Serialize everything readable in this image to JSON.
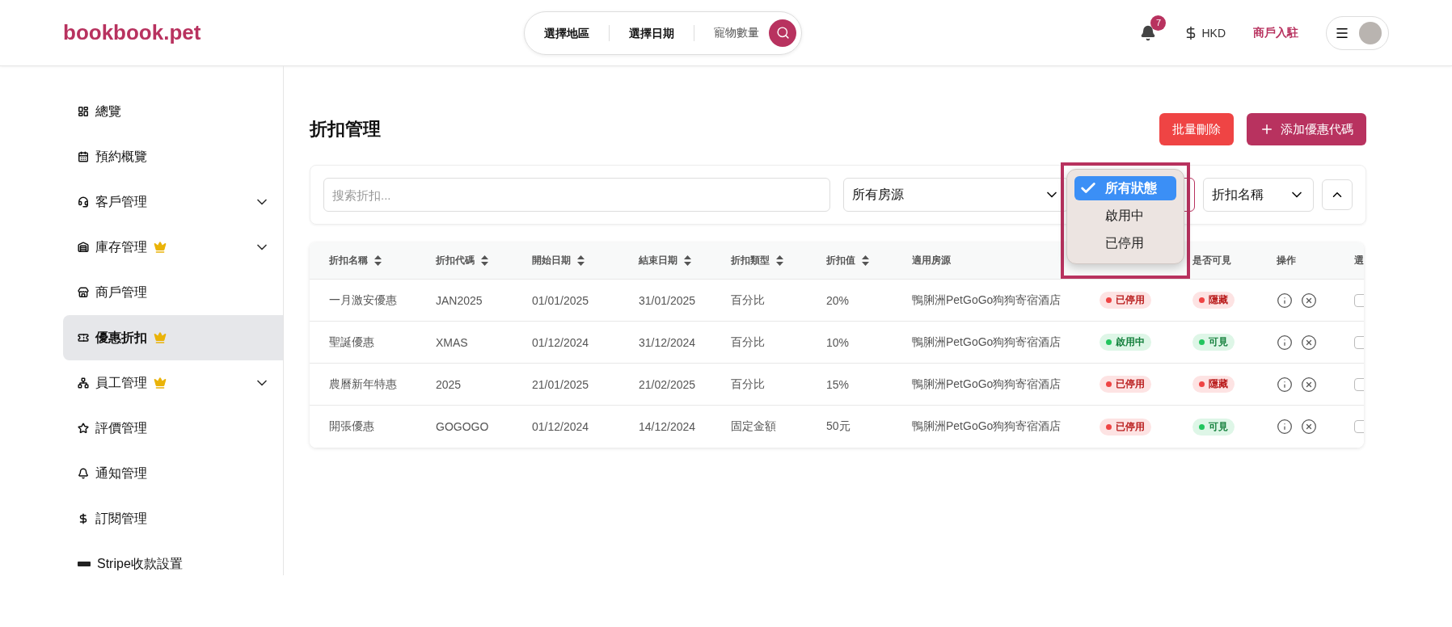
{
  "header": {
    "logo": "bookbook.pet",
    "search": {
      "segments": [
        "選擇地區",
        "選擇日期"
      ],
      "placeholder": "寵物數量"
    },
    "notifications": "7",
    "currency": "HKD",
    "merchant_link": "商戶入駐"
  },
  "sidebar": {
    "items": [
      {
        "label": "總覽",
        "selected": false,
        "premium": false,
        "expandable": false
      },
      {
        "label": "預約概覽",
        "selected": false,
        "premium": false,
        "expandable": false
      },
      {
        "label": "客戶管理",
        "selected": false,
        "premium": false,
        "expandable": true
      },
      {
        "label": "庫存管理",
        "selected": false,
        "premium": true,
        "expandable": true
      },
      {
        "label": "商戶管理",
        "selected": false,
        "premium": false,
        "expandable": false
      },
      {
        "label": "優惠折扣",
        "selected": true,
        "premium": true,
        "expandable": false
      },
      {
        "label": "員工管理",
        "selected": false,
        "premium": true,
        "expandable": true
      },
      {
        "label": "評價管理",
        "selected": false,
        "premium": false,
        "expandable": false
      },
      {
        "label": "通知管理",
        "selected": false,
        "premium": false,
        "expandable": false
      },
      {
        "label": "訂閱管理",
        "selected": false,
        "premium": false,
        "expandable": false
      },
      {
        "label": "Stripe收款設置",
        "selected": false,
        "premium": false,
        "expandable": false
      }
    ]
  },
  "page": {
    "title": "折扣管理",
    "buttons": [
      {
        "label": "批量刪除",
        "kind": "danger"
      },
      {
        "label": "添加優惠代碼",
        "kind": "add"
      }
    ]
  },
  "filters": {
    "search": {
      "placeholder": "搜索折扣..."
    },
    "property_select": "所有房源",
    "sort_select": "折扣名稱",
    "status_dropdown": {
      "options": [
        {
          "label": "所有狀態",
          "selected": true
        },
        {
          "label": "啟用中",
          "selected": false
        },
        {
          "label": "已停用",
          "selected": false
        }
      ]
    }
  },
  "table": {
    "columns": [
      {
        "label": "折扣名稱",
        "sortable": true
      },
      {
        "label": "折扣代碼",
        "sortable": true
      },
      {
        "label": "開始日期",
        "sortable": true
      },
      {
        "label": "結束日期",
        "sortable": true
      },
      {
        "label": "折扣類型",
        "sortable": true
      },
      {
        "label": "折扣值",
        "sortable": true
      },
      {
        "label": "適用房源",
        "sortable": false
      },
      {
        "label": "是否可見",
        "sortable": false
      },
      {
        "label": "操作",
        "sortable": false
      },
      {
        "label": "選"
      }
    ],
    "rows": [
      {
        "name": "一月激安優惠",
        "code": "JAN2025",
        "start": "01/01/2025",
        "end": "31/01/2025",
        "type": "百分比",
        "value": "20%",
        "property": "鴨脷洲PetGoGo狗狗寄宿酒店",
        "status": {
          "label": "已停用",
          "color": "#ef4444"
        },
        "visibility": {
          "label": "隱藏",
          "color": "#ef4444"
        },
        "checked": false
      },
      {
        "name": "聖誕優惠",
        "code": "XMAS",
        "start": "01/12/2024",
        "end": "31/12/2024",
        "type": "百分比",
        "value": "10%",
        "property": "鴨脷洲PetGoGo狗狗寄宿酒店",
        "status": {
          "label": "啟用中",
          "color": "#22c55e"
        },
        "visibility": {
          "label": "可見",
          "color": "#22c55e"
        },
        "checked": false
      },
      {
        "name": "農曆新年特惠",
        "code": "2025",
        "start": "21/01/2025",
        "end": "21/02/2025",
        "type": "百分比",
        "value": "15%",
        "property": "鴨脷洲PetGoGo狗狗寄宿酒店",
        "status": {
          "label": "已停用",
          "color": "#ef4444"
        },
        "visibility": {
          "label": "隱藏",
          "color": "#ef4444"
        },
        "checked": false
      },
      {
        "name": "開張優惠",
        "code": "GOGOGO",
        "start": "01/12/2024",
        "end": "14/12/2024",
        "type": "固定金額",
        "value": "50元",
        "property": "鴨脷洲PetGoGo狗狗寄宿酒店",
        "status": {
          "label": "已停用",
          "color": "#ef4444"
        },
        "visibility": {
          "label": "可見",
          "color": "#22c55e"
        },
        "checked": false
      }
    ]
  }
}
